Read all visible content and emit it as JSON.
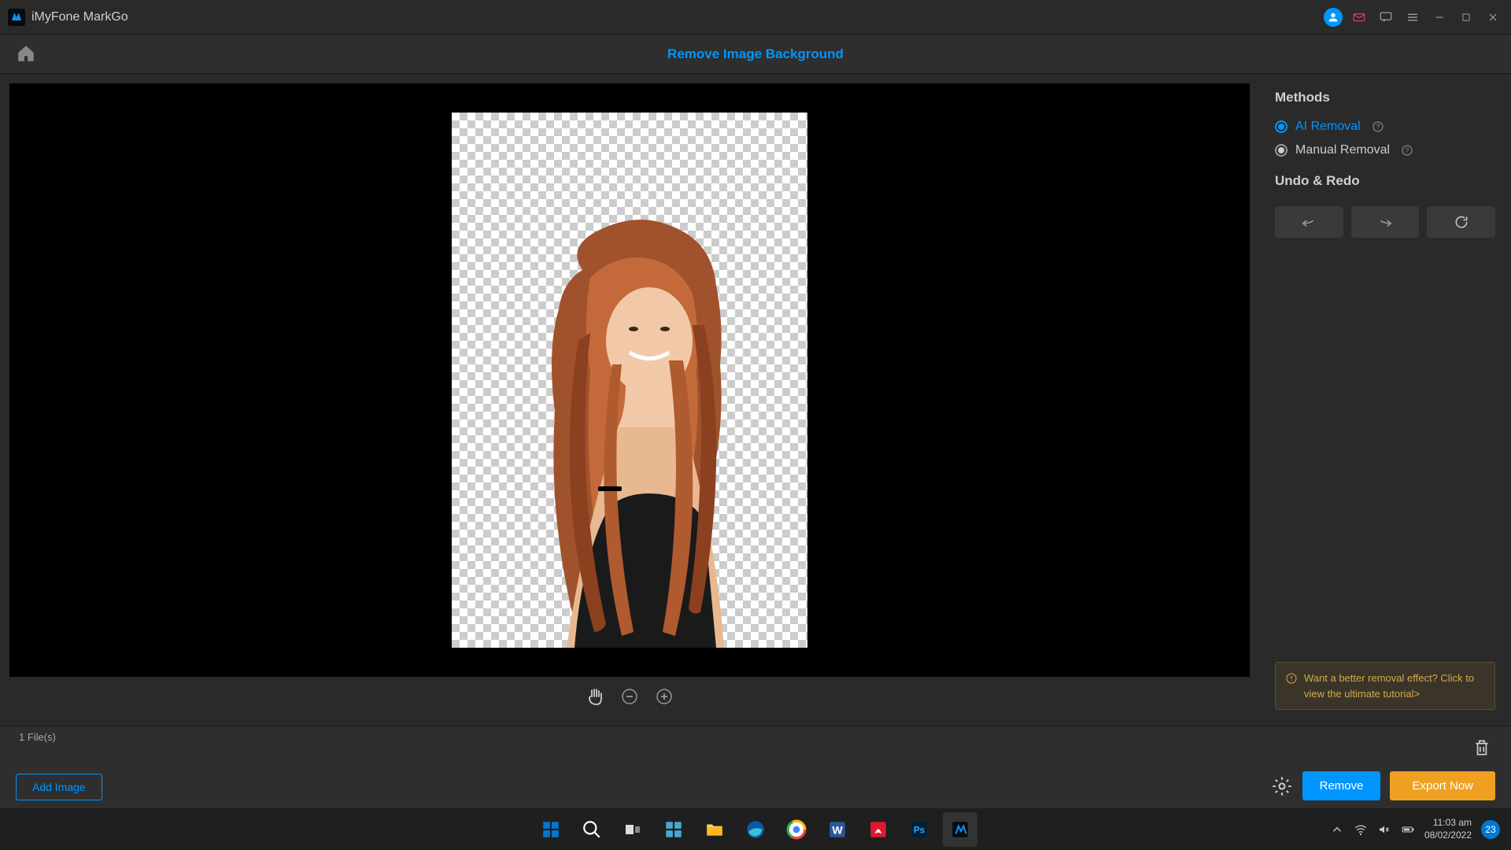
{
  "titlebar": {
    "app_name": "iMyFone MarkGo"
  },
  "header": {
    "page_title": "Remove Image Background"
  },
  "side_panel": {
    "methods_title": "Methods",
    "ai_removal": "AI Removal",
    "manual_removal": "Manual Removal",
    "undo_redo_title": "Undo & Redo",
    "tutorial_text": "Want a better removal effect? Click to view the ultimate tutorial>"
  },
  "bottom": {
    "file_count": "1 File(s)",
    "add_image": "Add Image",
    "remove": "Remove",
    "export": "Export Now"
  },
  "taskbar": {
    "time": "11:03 am",
    "date": "08/02/2022",
    "notif_count": "23"
  }
}
